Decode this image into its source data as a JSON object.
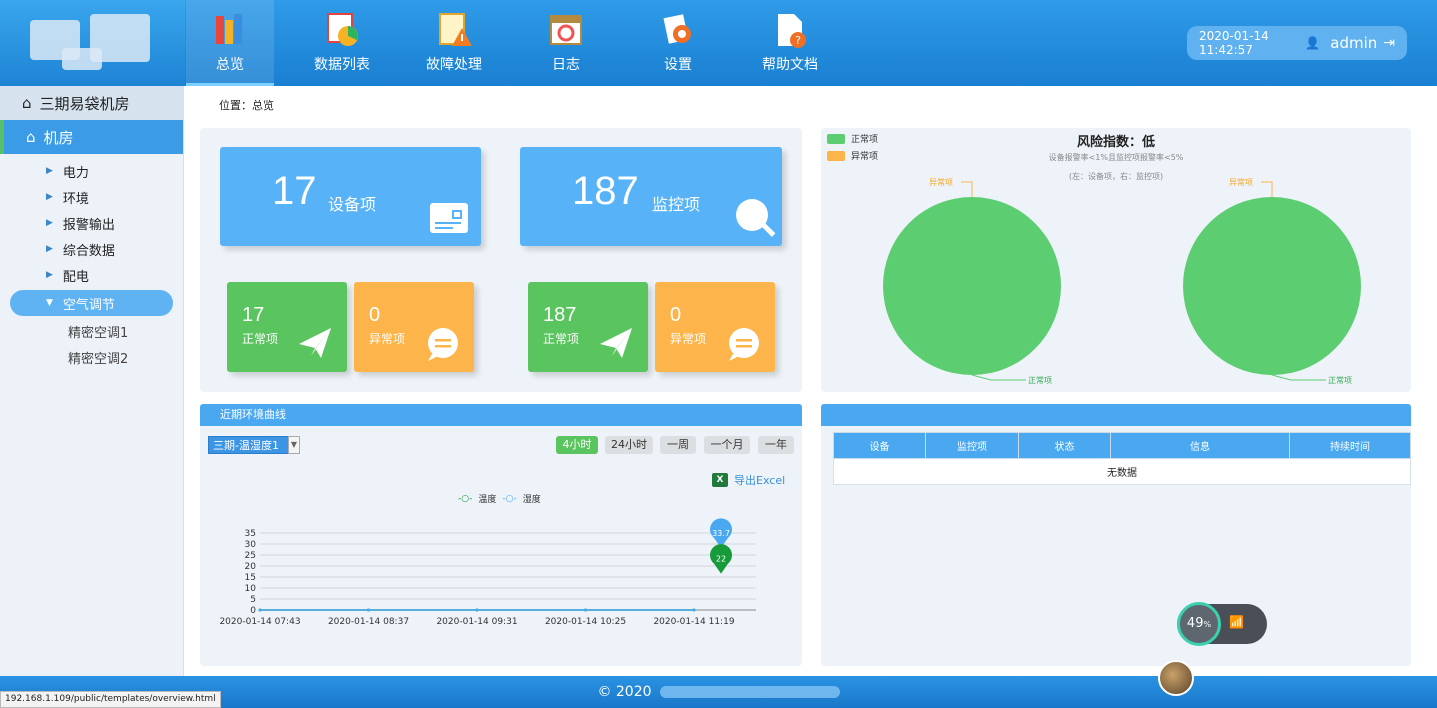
{
  "header": {
    "nav": [
      {
        "label": "总览",
        "icon": "books-icon"
      },
      {
        "label": "数据列表",
        "icon": "chart-list-icon"
      },
      {
        "label": "故障处理",
        "icon": "warning-notepad-icon"
      },
      {
        "label": "日志",
        "icon": "calendar-log-icon"
      },
      {
        "label": "设置",
        "icon": "gear-icon"
      },
      {
        "label": "帮助文档",
        "icon": "help-document-icon"
      }
    ],
    "datetime": "2020-01-14 11:42:57",
    "user": "admin"
  },
  "sidebar": {
    "top": "三期易袋机房",
    "room": "机房",
    "items": [
      "电力",
      "环境",
      "报警输出",
      "综合数据",
      "配电",
      "空气调节"
    ],
    "sub_items": [
      "精密空调1",
      "精密空调2"
    ]
  },
  "breadcrumb": "位置：总览",
  "summary": {
    "device_count": "17",
    "device_label": "设备项",
    "monitor_count": "187",
    "monitor_label": "监控项",
    "device_normal": "17",
    "device_abnormal": "0",
    "monitor_normal": "187",
    "monitor_abnormal": "0",
    "normal_label": "正常项",
    "abnormal_label": "异常项"
  },
  "risk": {
    "title": "风险指数：低",
    "subtitle": "设备报警率<1%且监控项报警率<5%",
    "note": "(左：设备项，右：监控项)",
    "legend_normal": "正常项",
    "legend_abnormal": "异常项",
    "colors": {
      "normal": "#5ccd71",
      "abnormal": "#fdb44a"
    }
  },
  "curve": {
    "title": "近期环境曲线",
    "select": "三期-温湿度1",
    "ranges": [
      "4小时",
      "24小时",
      "一周",
      "一个月",
      "一年"
    ],
    "active_range": "4小时",
    "export": "导出Excel",
    "legend": [
      "温度",
      "湿度"
    ]
  },
  "alarm_table": {
    "columns": [
      "设备",
      "监控项",
      "状态",
      "信息",
      "持续时间"
    ],
    "empty": "无数据"
  },
  "chart_data": {
    "type": "line",
    "x": [
      "2020-01-14 07:43",
      "2020-01-14 08:37",
      "2020-01-14 09:31",
      "2020-01-14 10:25",
      "2020-01-14 11:19"
    ],
    "series": [
      {
        "name": "温度",
        "values": [
          0,
          0,
          0,
          0,
          22
        ],
        "color": "#169a3a"
      },
      {
        "name": "湿度",
        "values": [
          0,
          0,
          0,
          0,
          33.7
        ],
        "color": "#4aa8f0"
      }
    ],
    "marker_labels": [
      "33.7",
      "22"
    ],
    "yticks": [
      "0",
      "5",
      "10",
      "15",
      "20",
      "25",
      "30",
      "35"
    ],
    "ylim": [
      0,
      35
    ]
  },
  "footer": {
    "copyright": "© 2020"
  },
  "status_url": "192.168.1.109/public/templates/overview.html",
  "widget": {
    "percent": "49",
    "unit": "%"
  }
}
